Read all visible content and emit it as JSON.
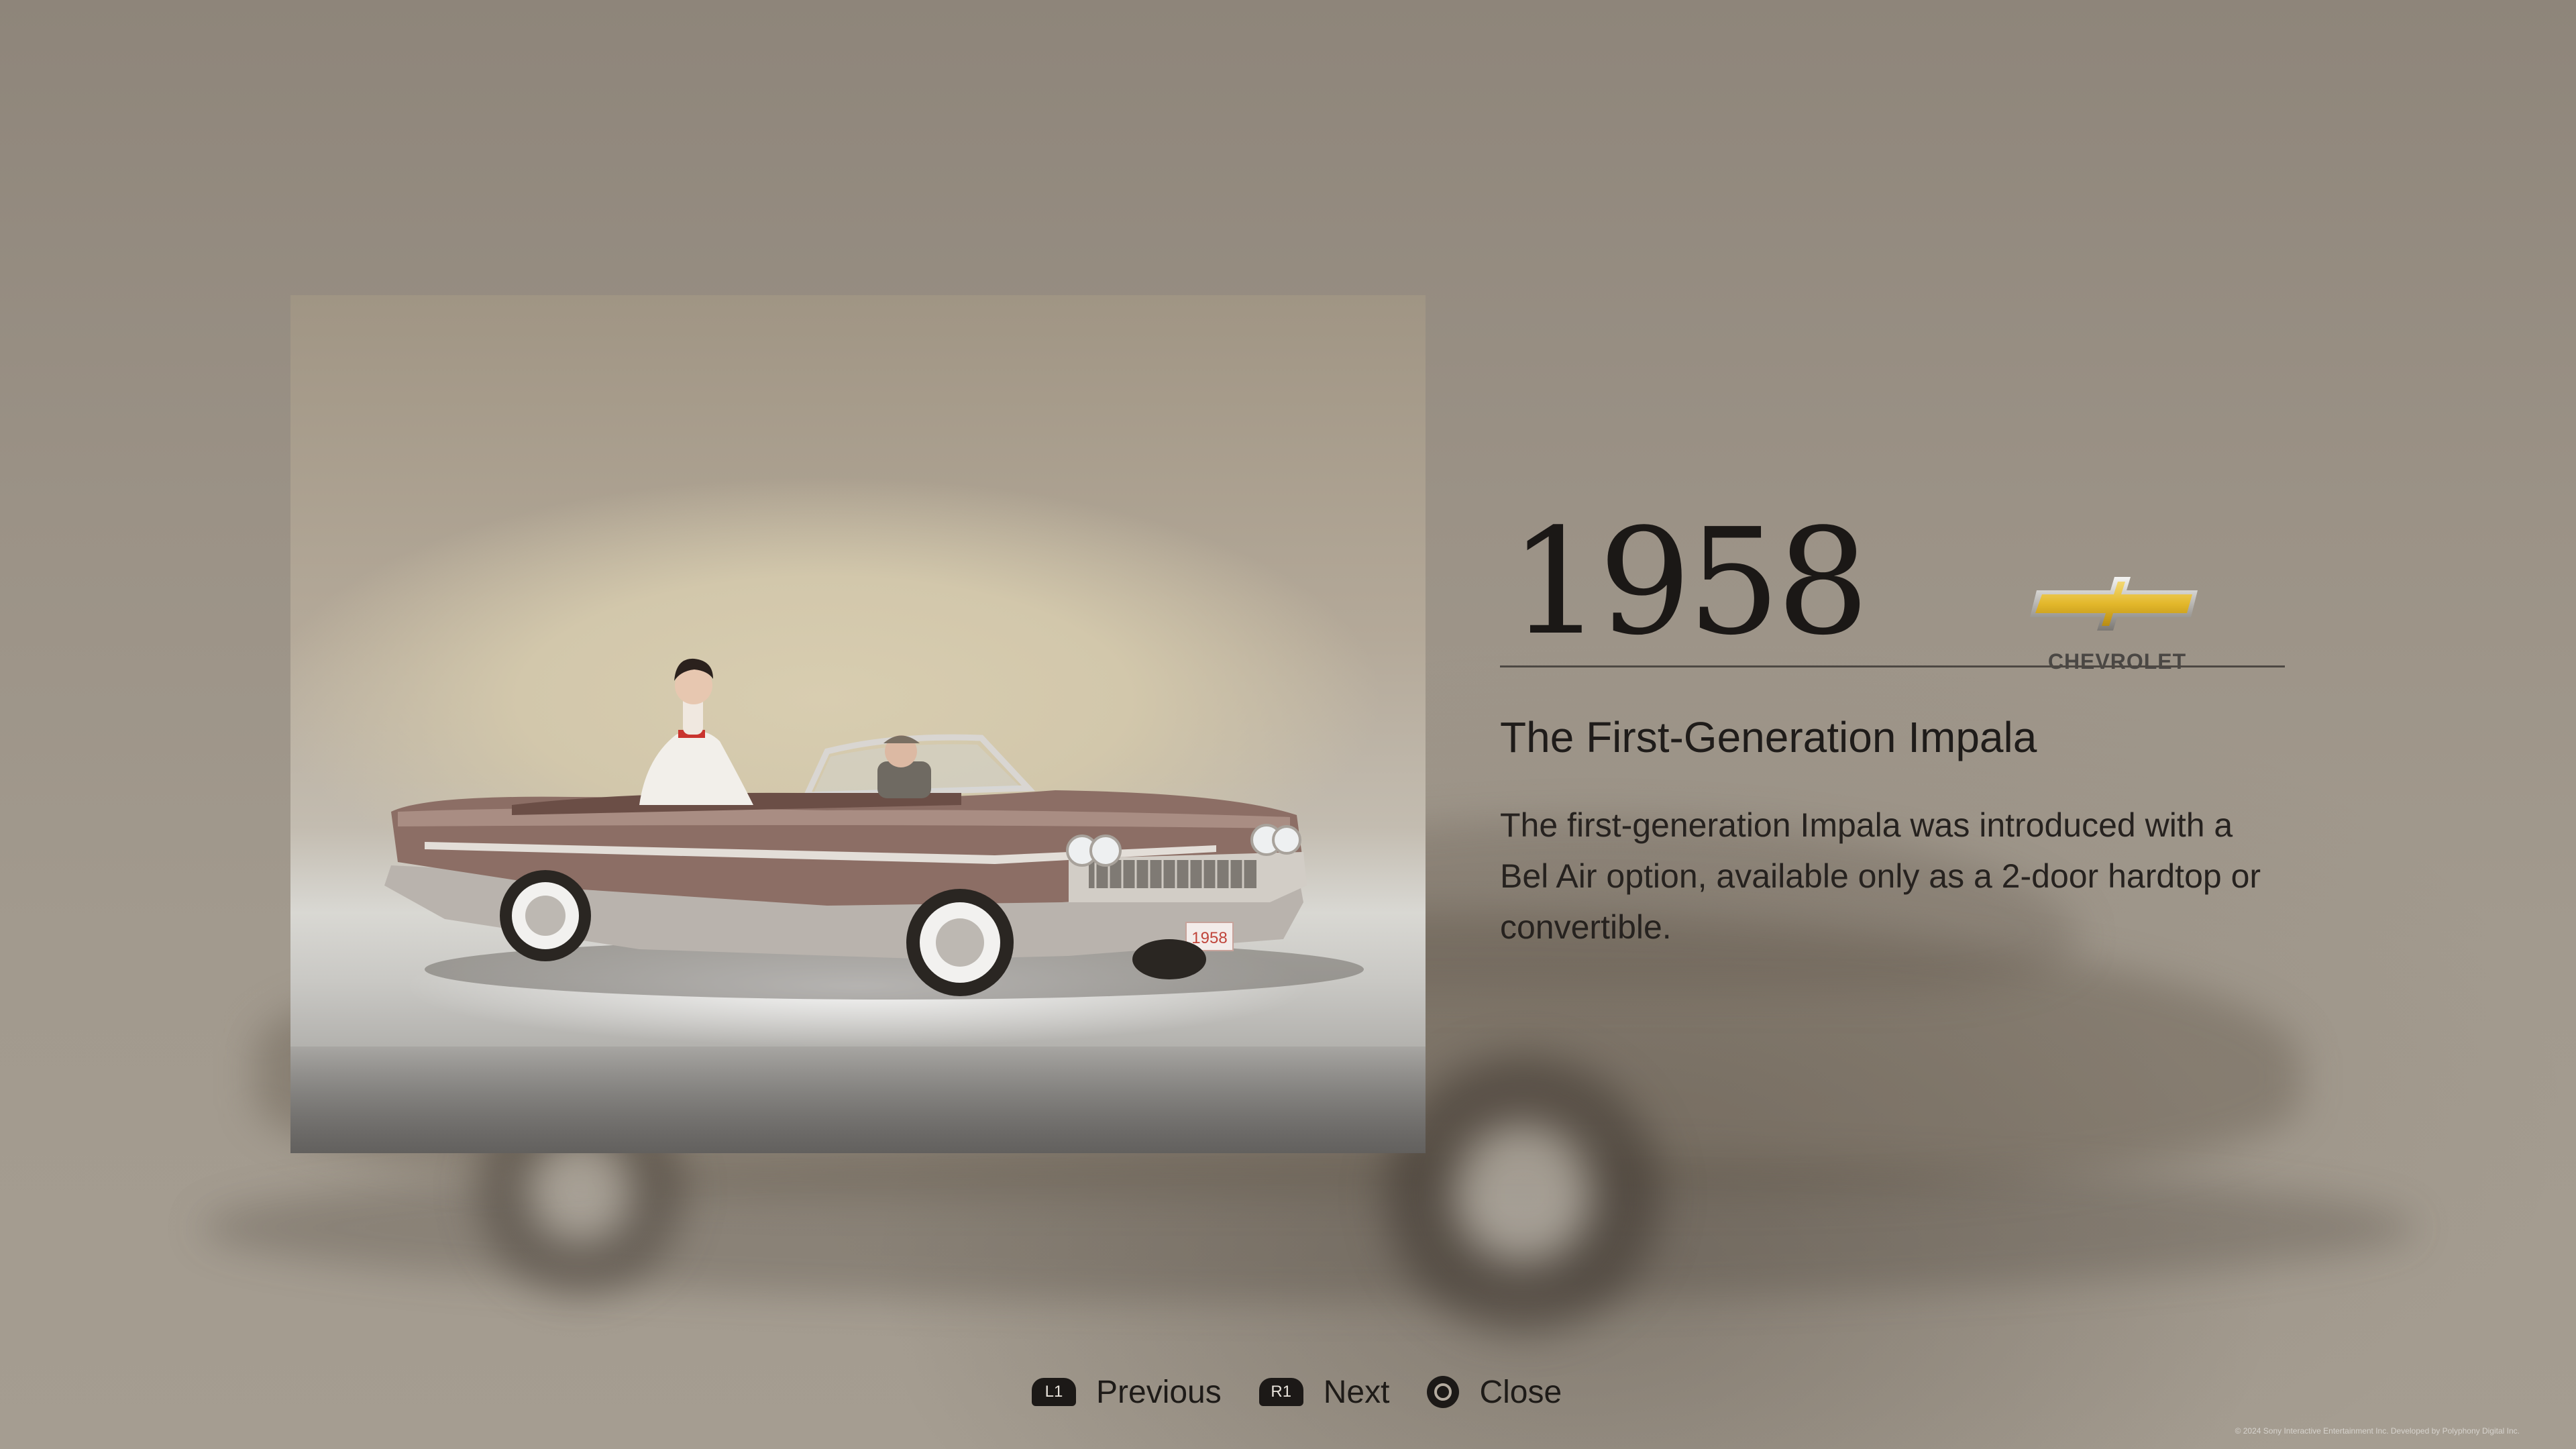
{
  "gallery": {
    "year": "1958",
    "brand": {
      "name": "CHEVROLET",
      "logo_icon": "chevrolet-bowtie-icon",
      "logo_color": "#e8c235"
    },
    "headline": "The First-Generation Impala",
    "description": "The first-generation Impala was introduced with a Bel Air option, available only as a 2-door hardtop or convertible.",
    "photo": {
      "license_plate": "1958"
    }
  },
  "controls": {
    "previous": {
      "button": "L1",
      "label": "Previous"
    },
    "next": {
      "button": "R1",
      "label": "Next"
    },
    "close": {
      "button_icon": "circle-button-icon",
      "label": "Close"
    }
  },
  "footer": {
    "copyright": "© 2024 Sony Interactive Entertainment Inc. Developed by Polyphony Digital Inc."
  }
}
